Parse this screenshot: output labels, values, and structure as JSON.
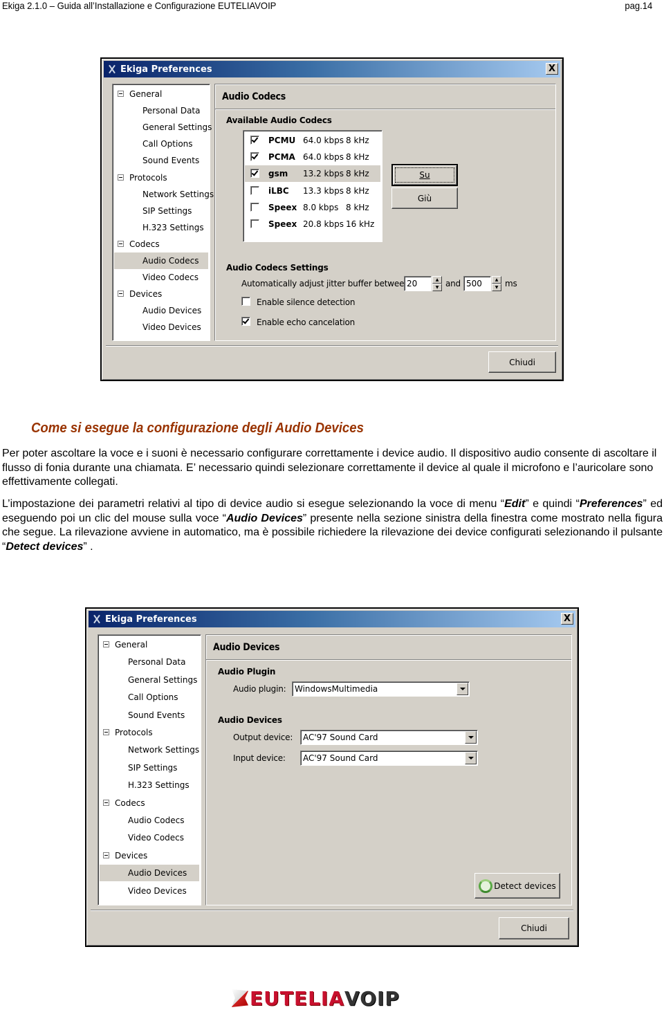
{
  "page_header": {
    "title": "Ekiga 2.1.0 – Guida all’Installazione e Configurazione EUTELIAVOIP",
    "page_number": "pag.14"
  },
  "dialog1": {
    "title": "Ekiga Preferences",
    "close_label": "X",
    "tree": [
      {
        "label": "General",
        "type": "category",
        "expanded": true
      },
      {
        "label": "Personal Data",
        "type": "item"
      },
      {
        "label": "General Settings",
        "type": "item"
      },
      {
        "label": "Call Options",
        "type": "item"
      },
      {
        "label": "Sound Events",
        "type": "item"
      },
      {
        "label": "Protocols",
        "type": "category",
        "expanded": true
      },
      {
        "label": "Network Settings",
        "type": "item"
      },
      {
        "label": "SIP Settings",
        "type": "item"
      },
      {
        "label": "H.323 Settings",
        "type": "item"
      },
      {
        "label": "Codecs",
        "type": "category",
        "expanded": true
      },
      {
        "label": "Audio Codecs",
        "type": "item",
        "selected": true
      },
      {
        "label": "Video Codecs",
        "type": "item"
      },
      {
        "label": "Devices",
        "type": "category",
        "expanded": true
      },
      {
        "label": "Audio Devices",
        "type": "item"
      },
      {
        "label": "Video Devices",
        "type": "item"
      }
    ],
    "panel_title": "Audio Codecs",
    "available_title": "Available Audio Codecs",
    "codecs": [
      {
        "name": "PCMU",
        "rate": "64.0 kbps",
        "freq": "8 kHz",
        "checked": true
      },
      {
        "name": "PCMA",
        "rate": "64.0 kbps",
        "freq": "8 kHz",
        "checked": true
      },
      {
        "name": "gsm",
        "rate": "13.2 kbps",
        "freq": "8 kHz",
        "checked": true,
        "selected": true
      },
      {
        "name": "iLBC",
        "rate": "13.3 kbps",
        "freq": "8 kHz",
        "checked": false
      },
      {
        "name": "Speex",
        "rate": "8.0 kbps",
        "freq": "8 kHz",
        "checked": false
      },
      {
        "name": "Speex",
        "rate": "20.8 kbps",
        "freq": "16 kHz",
        "checked": false
      }
    ],
    "up_button": "Su",
    "down_button": "Giù",
    "settings_title": "Audio Codecs Settings",
    "jitter_label": "Automatically adjust jitter buffer between",
    "jitter_min": "20",
    "jitter_and": "and",
    "jitter_max": "500",
    "jitter_unit": "ms",
    "silence_label": "Enable silence detection",
    "silence_checked": false,
    "echo_label": "Enable echo cancelation",
    "echo_checked": true,
    "close_button": "Chiudi"
  },
  "section": {
    "heading": "Come si esegue la configurazione degli Audio Devices",
    "para1": "Per poter ascoltare la voce e i suoni è necessario configurare correttamente i device audio. Il dispositivo audio consente di ascoltare il flusso di fonia durante una chiamata. E’ necessario quindi selezionare correttamente il device al quale il microfono e l’auricolare sono effettivamente collegati.",
    "para2": {
      "t1": "L’impostazione dei parametri relativi al tipo di device audio si esegue selezionando la voce di menu “",
      "b1": "Edit",
      "t2": "” e quindi “",
      "b2": "Preferences",
      "t3": "” ed eseguendo poi un clic del mouse sulla voce “",
      "b3": "Audio Devices",
      "t4": "” presente nella sezione sinistra della finestra come mostrato nella figura che segue. La rilevazione avviene in automatico, ma è possibile richiedere la rilevazione dei device configurati selezionando il pulsante “",
      "b4": "Detect devices",
      "t5": "” ."
    }
  },
  "dialog2": {
    "title": "Ekiga Preferences",
    "close_label": "X",
    "tree": [
      {
        "label": "General",
        "type": "category",
        "expanded": true
      },
      {
        "label": "Personal Data",
        "type": "item"
      },
      {
        "label": "General Settings",
        "type": "item"
      },
      {
        "label": "Call Options",
        "type": "item"
      },
      {
        "label": "Sound Events",
        "type": "item"
      },
      {
        "label": "Protocols",
        "type": "category",
        "expanded": true
      },
      {
        "label": "Network Settings",
        "type": "item"
      },
      {
        "label": "SIP Settings",
        "type": "item"
      },
      {
        "label": "H.323 Settings",
        "type": "item"
      },
      {
        "label": "Codecs",
        "type": "category",
        "expanded": true
      },
      {
        "label": "Audio Codecs",
        "type": "item"
      },
      {
        "label": "Video Codecs",
        "type": "item"
      },
      {
        "label": "Devices",
        "type": "category",
        "expanded": true
      },
      {
        "label": "Audio Devices",
        "type": "item",
        "selected": true
      },
      {
        "label": "Video Devices",
        "type": "item"
      }
    ],
    "panel_title": "Audio Devices",
    "plugin_title": "Audio Plugin",
    "plugin_label": "Audio plugin:",
    "plugin_value": "WindowsMultimedia",
    "devices_title": "Audio Devices",
    "output_label": "Output device:",
    "output_value": "AC'97 Sound Card",
    "input_label": "Input device:",
    "input_value": "AC'97 Sound Card",
    "detect_button": "Detect devices",
    "detect_icon": "refresh-icon",
    "close_button": "Chiudi"
  },
  "footer_logo": {
    "part1": "EUTELIA",
    "part2": "VOIP"
  }
}
